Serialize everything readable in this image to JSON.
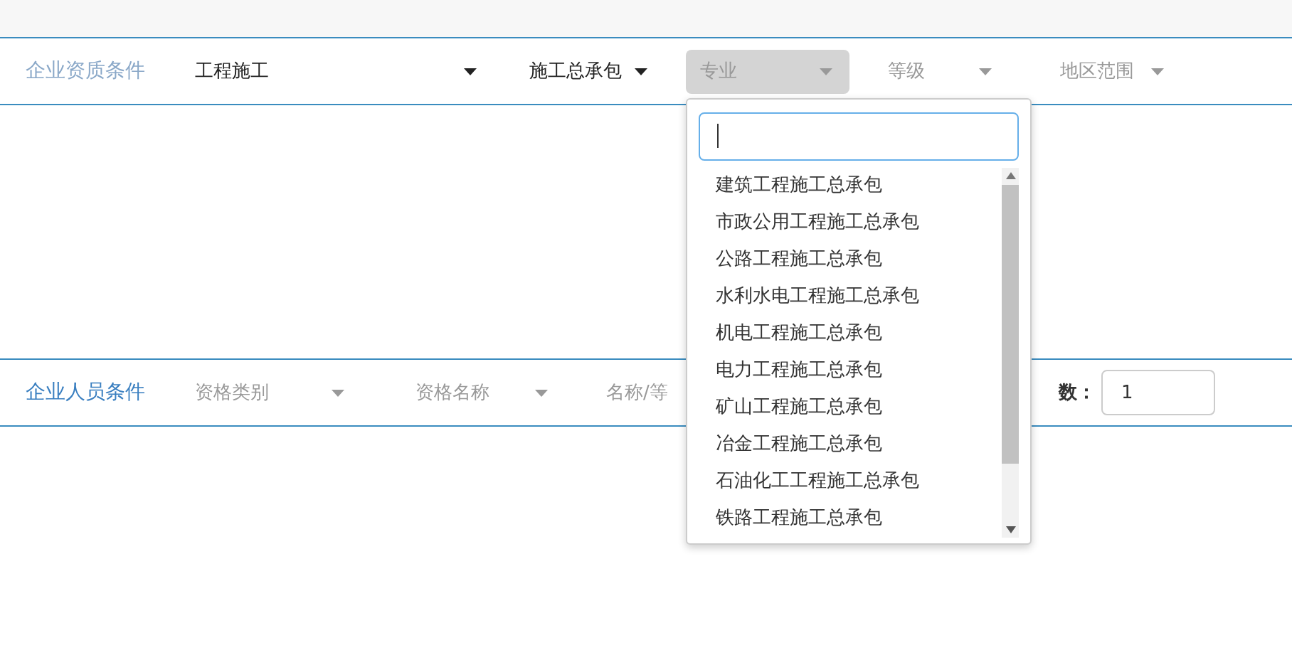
{
  "sections": [
    {
      "title": "企业资质条件",
      "fields": [
        {
          "kind": "select",
          "value": "工程施工",
          "open": false
        },
        {
          "kind": "select",
          "value": "施工总承包",
          "open": false
        },
        {
          "kind": "select",
          "placeholder": "专业",
          "open": true
        },
        {
          "kind": "select",
          "placeholder": "等级",
          "open": false
        },
        {
          "kind": "select",
          "placeholder": "地区范围",
          "open": false
        }
      ]
    },
    {
      "title": "企业人员条件",
      "fields": [
        {
          "kind": "select",
          "placeholder": "资格类别",
          "open": false
        },
        {
          "kind": "select",
          "placeholder": "资格名称",
          "open": false
        },
        {
          "kind": "text",
          "label": "名称/等"
        },
        {
          "kind": "number",
          "label": "数：",
          "value": "1"
        }
      ]
    }
  ],
  "dropdown": {
    "options": [
      "建筑工程施工总承包",
      "市政公用工程施工总承包",
      "公路工程施工总承包",
      "水利水电工程施工总承包",
      "机电工程施工总承包",
      "电力工程施工总承包",
      "矿山工程施工总承包",
      "冶金工程施工总承包",
      "石油化工工程施工总承包",
      "铁路工程施工总承包"
    ]
  }
}
